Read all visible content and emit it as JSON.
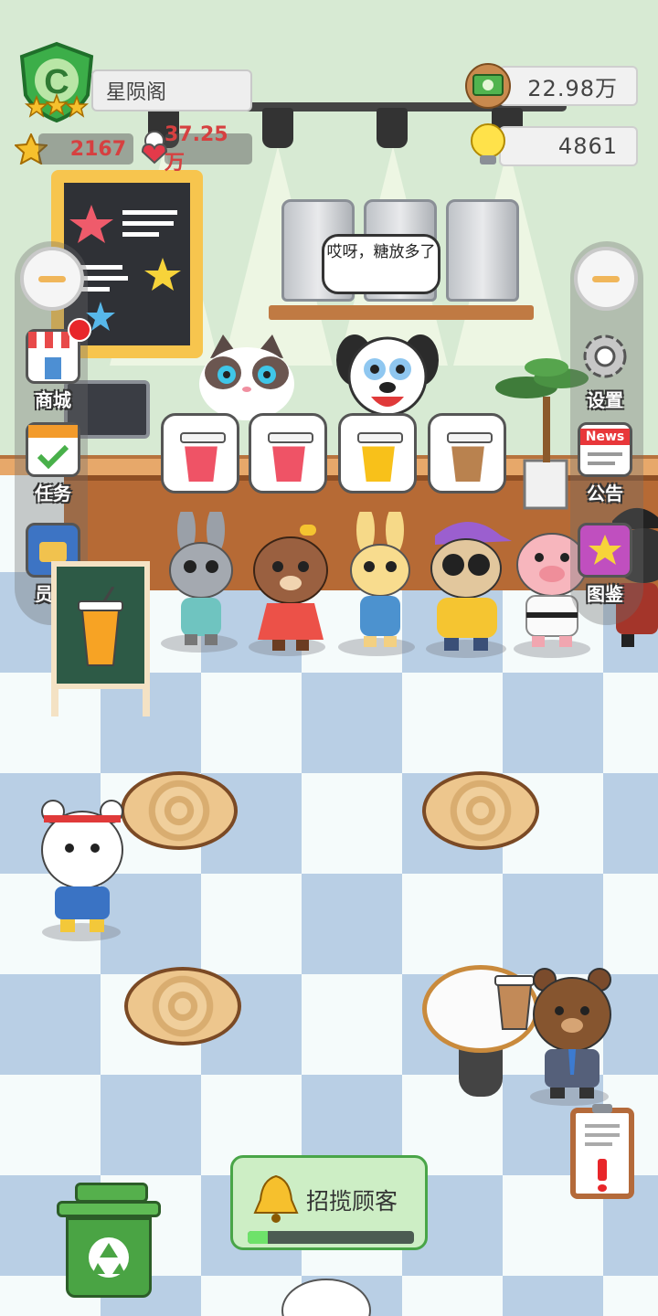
{
  "player": {
    "rank_letter": "C",
    "rank_stars": 3,
    "shop_name": "星陨阁",
    "stars": "2167",
    "hearts": "37.25万"
  },
  "resources": {
    "money": "22.98万",
    "ideas": "4861"
  },
  "speech": {
    "text": "哎呀，糖放多了"
  },
  "left_menu": [
    {
      "label": "商城",
      "badge": true
    },
    {
      "label": "任务",
      "badge": false
    },
    {
      "label": "员工",
      "badge": false
    }
  ],
  "right_menu": [
    {
      "label": "设置"
    },
    {
      "label": "公告",
      "icon_text": "News"
    },
    {
      "label": "图鉴"
    }
  ],
  "orders": [
    {
      "drink": "red-juice",
      "color": "#ef5366"
    },
    {
      "drink": "red-juice",
      "color": "#ef5366"
    },
    {
      "drink": "orange-juice",
      "color": "#f8c11a"
    },
    {
      "drink": "bubble-tea",
      "color": "#b9824f"
    }
  ],
  "recruit": {
    "label": "招揽顾客",
    "progress": 0.12
  },
  "colors": {
    "accent_green": "#49a548",
    "wall": "#d7ead3",
    "floor_tile": "#b9cfe5",
    "stat_red": "#d64040"
  }
}
